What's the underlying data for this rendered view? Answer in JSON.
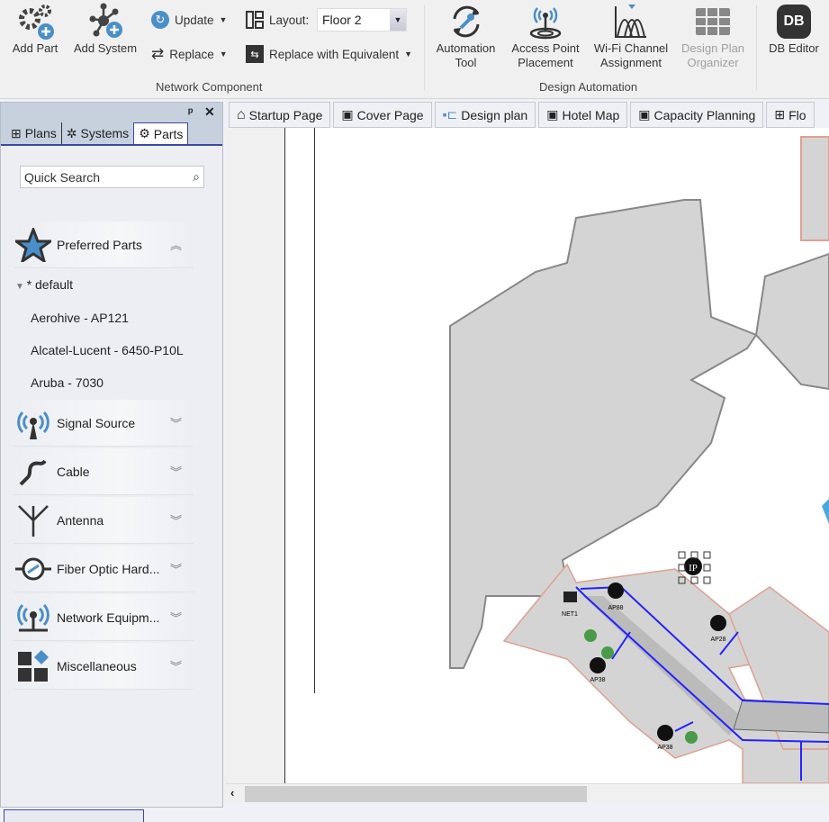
{
  "ribbon": {
    "add_part": "Add Part",
    "add_system": "Add System",
    "update": "Update",
    "replace": "Replace",
    "layout_label": "Layout:",
    "layout_value": "Floor 2",
    "replace_equivalent": "Replace with Equivalent",
    "group_network": "Network Component",
    "automation_tool": [
      "Automation",
      "Tool"
    ],
    "ap_placement": [
      "Access Point",
      "Placement"
    ],
    "wifi_channel": [
      "Wi-Fi Channel",
      "Assignment"
    ],
    "design_plan_organizer": [
      "Design Plan",
      "Organizer"
    ],
    "group_design": "Design Automation",
    "db_editor": "DB Editor",
    "db_logo": "DB"
  },
  "panel": {
    "tabs": [
      {
        "label": "Plans"
      },
      {
        "label": "Systems"
      },
      {
        "label": "Parts"
      }
    ],
    "search_placeholder": "Quick Search",
    "preferred": "Preferred Parts",
    "default_group": "* default",
    "items": [
      "Aerohive - AP121",
      "Alcatel-Lucent - 6450-P10L",
      "Aruba - 7030"
    ],
    "categories": [
      "Signal Source",
      "Cable",
      "Antenna",
      "Fiber Optic Hard...",
      "Network Equipm...",
      "Miscellaneous"
    ]
  },
  "doc_tabs": [
    "Startup Page",
    "Cover Page",
    "Design plan",
    "Hotel Map",
    "Capacity Planning",
    "Flo"
  ],
  "plan": {
    "labels": [
      "NET1",
      "AP88",
      "AP28",
      "AP38",
      "AP38"
    ],
    "ip_icon": "IP",
    "colors": {
      "cable": "#1a1aff",
      "wall": "#e0a090",
      "room": "#d4d4d4",
      "ap": "#111111",
      "marker": "#4a9a4a"
    }
  }
}
